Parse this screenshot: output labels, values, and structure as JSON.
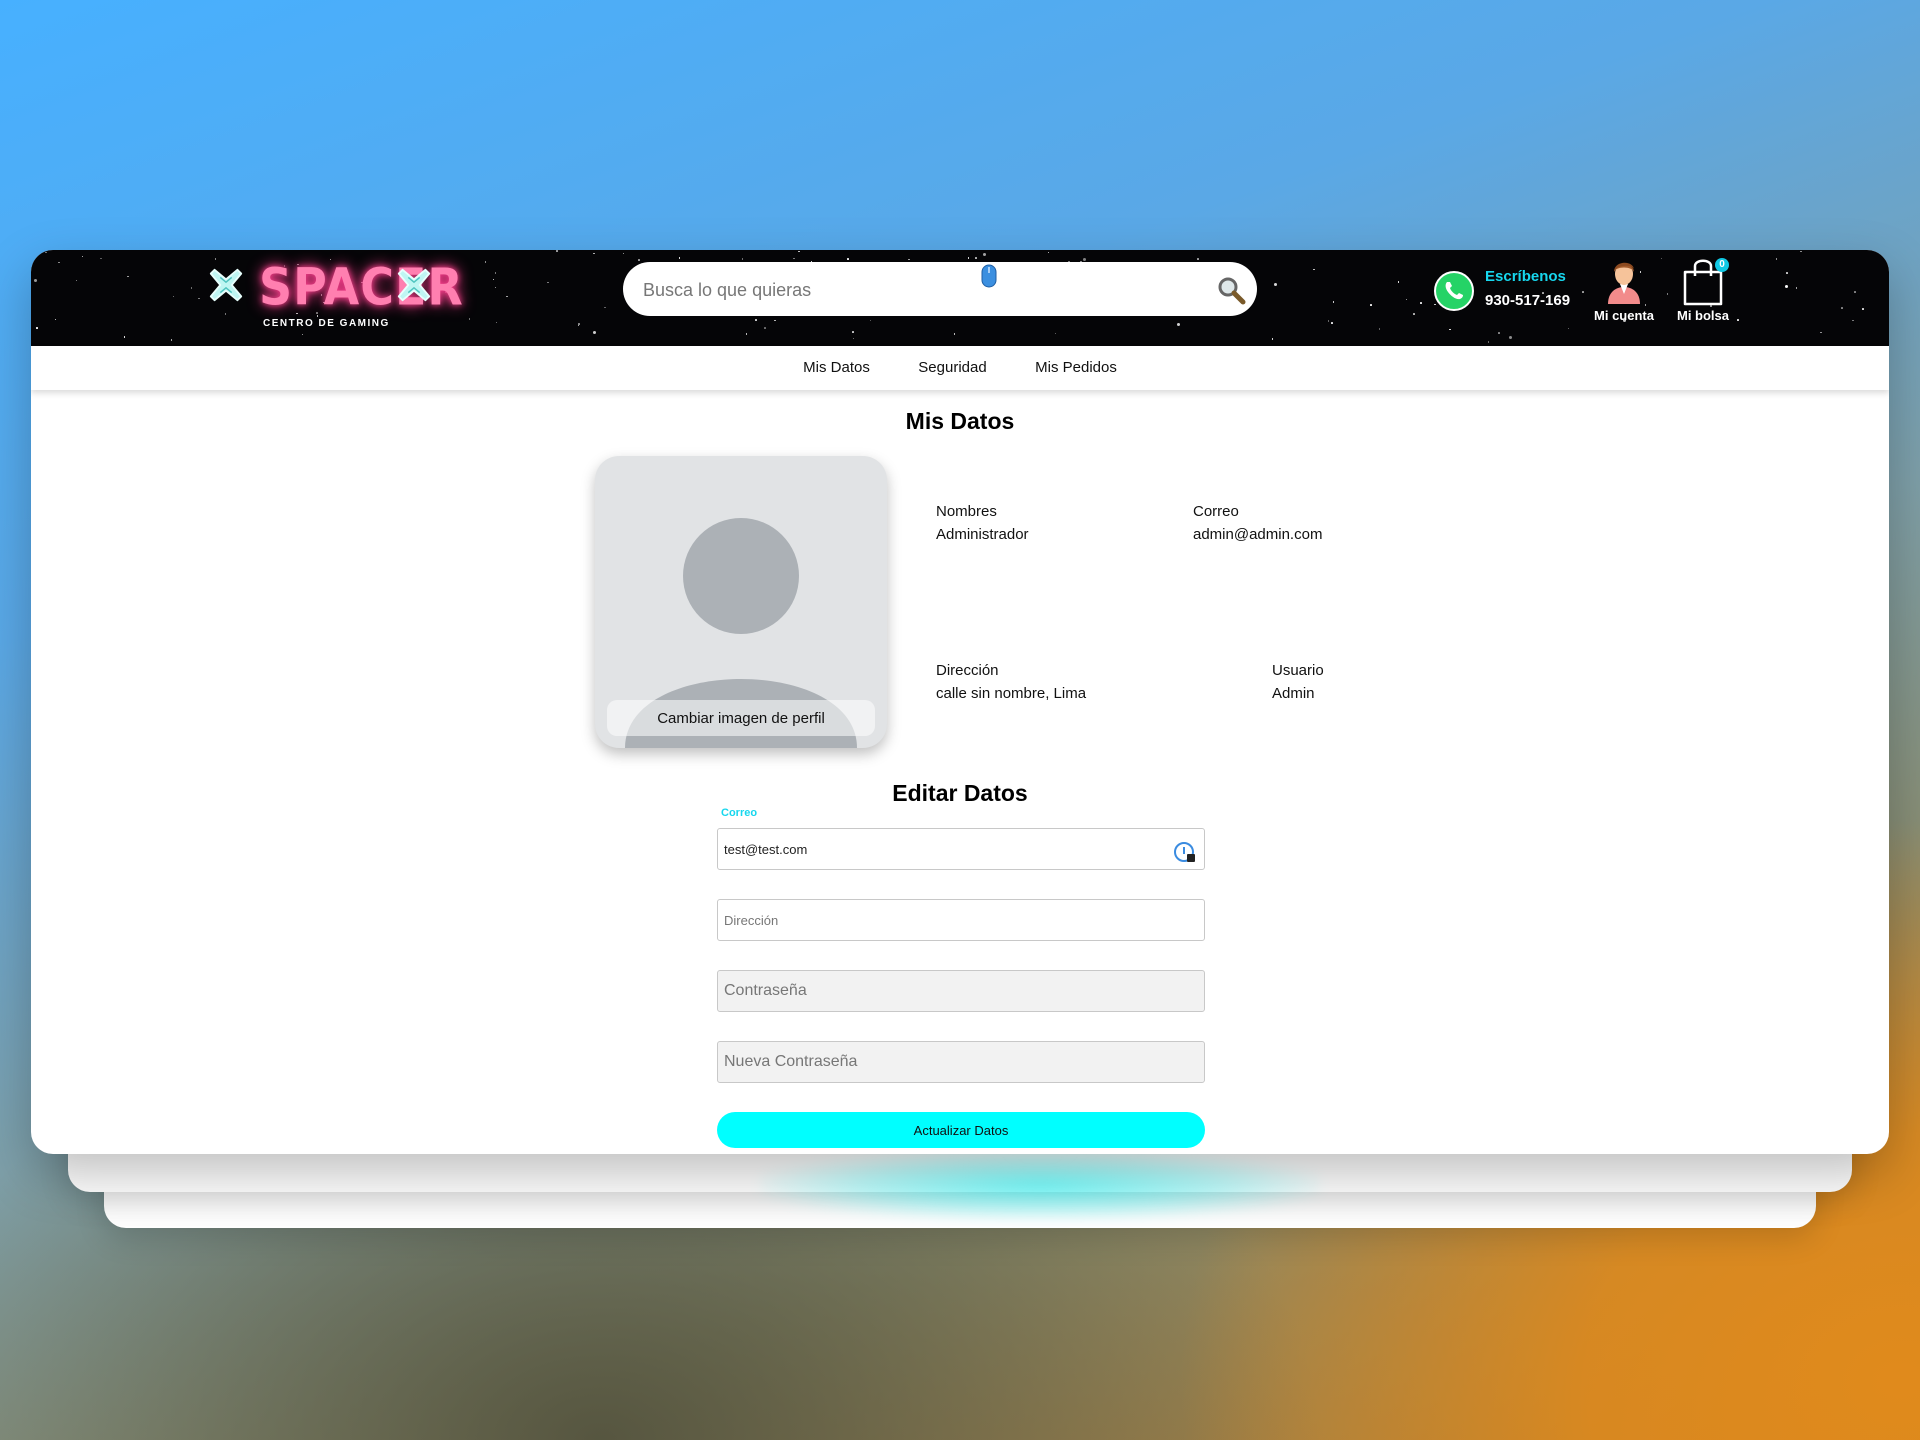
{
  "brand": {
    "name": "SPACER",
    "tagline": "CENTRO DE GAMING",
    "logo_icon": "cross-emblem-icon",
    "accent_pink": "#ff7fb0",
    "accent_cyan": "#17d7ee"
  },
  "search": {
    "placeholder": "Busca lo que quieras",
    "icon": "search-icon"
  },
  "contact": {
    "title": "Escríbenos",
    "phone": "930-517-169",
    "icon": "whatsapp-icon"
  },
  "account": {
    "label": "Mi cuenta",
    "icon": "user-avatar-icon"
  },
  "bag": {
    "label": "Mi bolsa",
    "count": "0",
    "icon": "shopping-bag-icon"
  },
  "tabs": [
    {
      "label": "Mis Datos"
    },
    {
      "label": "Seguridad"
    },
    {
      "label": "Mis Pedidos"
    }
  ],
  "profile": {
    "title": "Mis Datos",
    "change_photo_label": "Cambiar imagen de perfil",
    "fields": {
      "nombres": {
        "label": "Nombres",
        "value": "Administrador"
      },
      "correo": {
        "label": "Correo",
        "value": "admin@admin.com"
      },
      "direccion": {
        "label": "Dirección",
        "value": "calle sin nombre, Lima"
      },
      "usuario": {
        "label": "Usuario",
        "value": "Admin"
      }
    }
  },
  "edit": {
    "title": "Editar Datos",
    "email": {
      "label": "Correo",
      "value": "test@test.com"
    },
    "address": {
      "placeholder": "Dirección"
    },
    "password": {
      "placeholder": "Contraseña"
    },
    "new_password": {
      "placeholder": "Nueva Contraseña"
    },
    "submit_label": "Actualizar Datos",
    "button_color": "#00ffff"
  }
}
